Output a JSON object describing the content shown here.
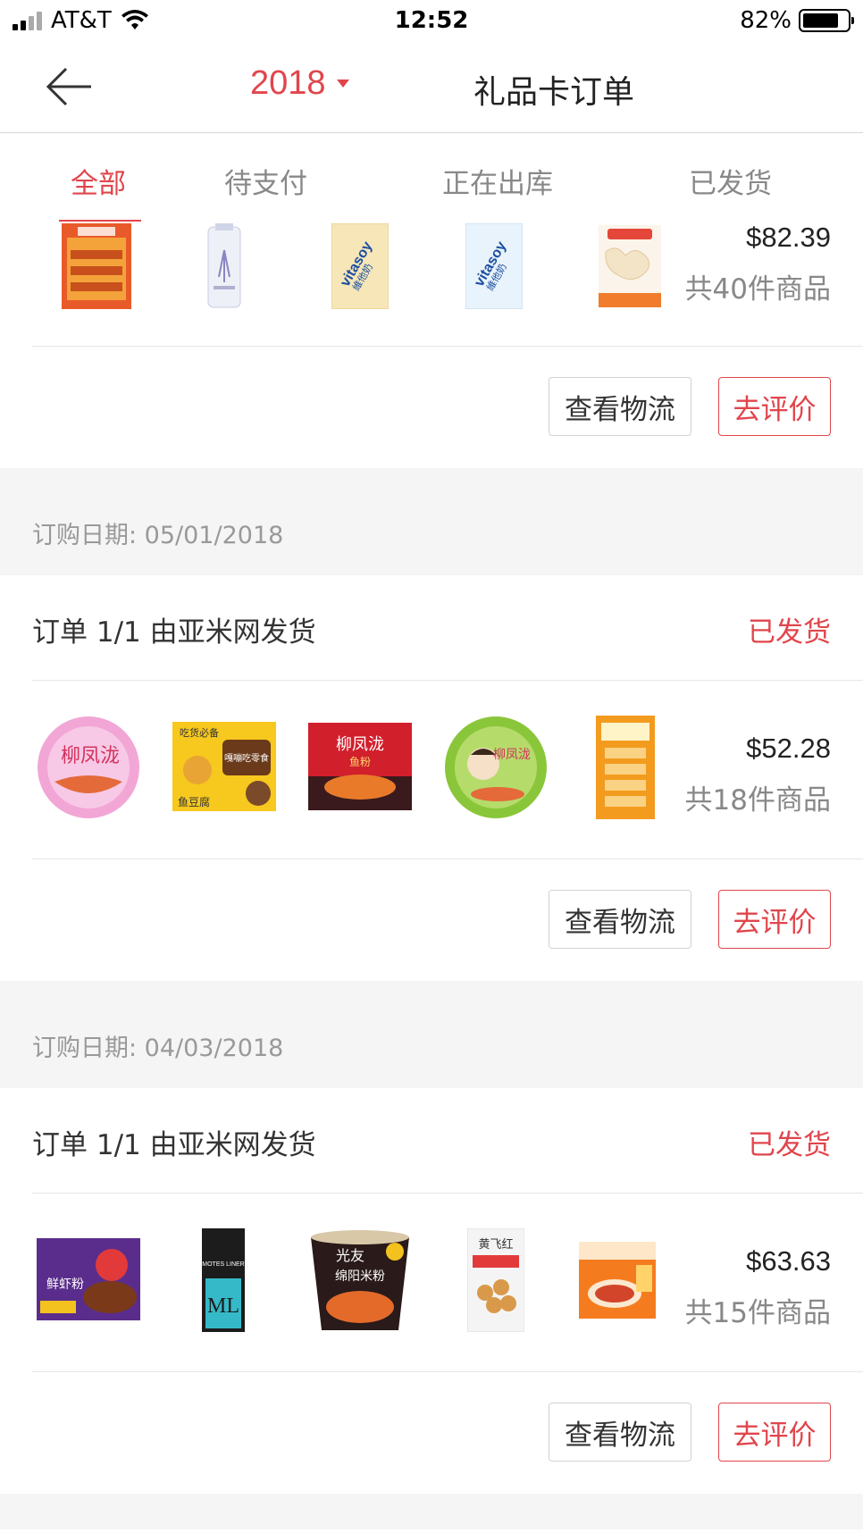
{
  "status_bar": {
    "carrier": "AT&T",
    "time": "12:52",
    "battery": "82%"
  },
  "nav": {
    "year": "2018",
    "title": "礼品卡订单"
  },
  "tabs": [
    {
      "label": "全部",
      "active": true
    },
    {
      "label": "待支付",
      "active": false
    },
    {
      "label": "正在出库",
      "active": false
    },
    {
      "label": "已发货",
      "active": false
    }
  ],
  "buttons": {
    "logistics": "查看物流",
    "review": "去评价"
  },
  "orders": [
    {
      "price": "$82.39",
      "count": "共40件商品",
      "products": [
        "red-snack-box",
        "lotion-bottle",
        "vitasoy-carton",
        "vitasoy-carton-2",
        "shrimp-flakes"
      ]
    },
    {
      "date": "订购日期: 05/01/2018",
      "title": "订单 1/1 由亚米网发货",
      "status": "已发货",
      "price": "$52.28",
      "count": "共18件商品",
      "products": [
        "noodle-bowl-pink",
        "yellow-snack-box",
        "red-noodle-pack",
        "noodle-bowl-green",
        "cracker-pack"
      ]
    },
    {
      "date": "订购日期: 04/03/2018",
      "title": "订单 1/1 由亚米网发货",
      "status": "已发货",
      "price": "$63.63",
      "count": "共15件商品",
      "products": [
        "purple-noodle-pack",
        "motes-liner",
        "guangyou-noodle-cup",
        "peanut-pack",
        "orange-noodle-pack"
      ]
    }
  ],
  "product_labels": {
    "vitasoy": "vitasoy",
    "vitasoy_cn": "維他奶",
    "noodle_brand": "柳凤泷",
    "noodle_sub": "鱼粉",
    "guangyou": "光友",
    "guangyou_sub": "绵阳米粉",
    "motes": "MOTES LINER",
    "ml": "ML",
    "yellow_a": "吃货必备",
    "yellow_b": "嘎嘣吃零食",
    "yellow_c": "鱼豆腐",
    "purple": "鲜虾粉",
    "peanut": "黄飞红"
  }
}
